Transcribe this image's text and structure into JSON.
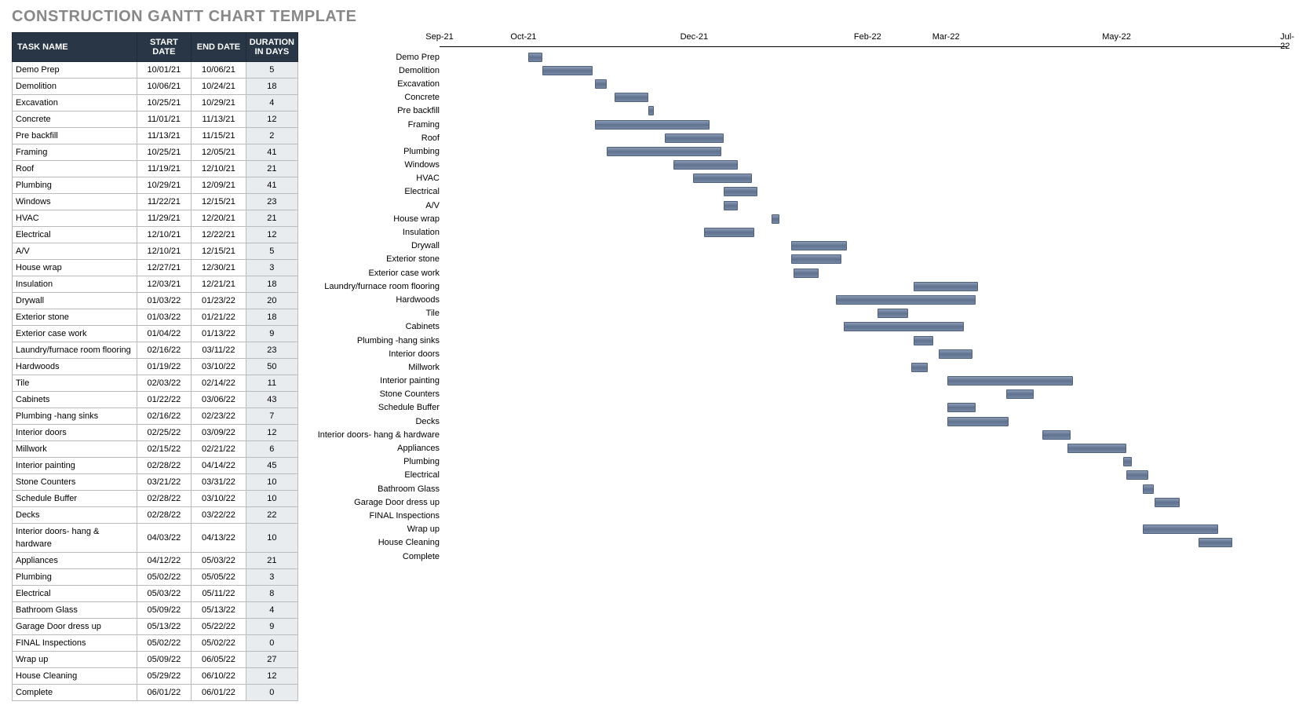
{
  "title": "CONSTRUCTION GANTT CHART TEMPLATE",
  "table": {
    "headers": {
      "name": "TASK NAME",
      "start": "START DATE",
      "end": "END DATE",
      "duration": "DURATION IN DAYS"
    }
  },
  "chart_data": {
    "type": "bar",
    "orientation": "horizontal-gantt",
    "x_axis": {
      "type": "date",
      "min": "2021-09-01",
      "max": "2022-07-01",
      "ticks": [
        "Sep-21",
        "Oct-21",
        "Dec-21",
        "Feb-22",
        "Mar-22",
        "May-22",
        "Jul-22"
      ],
      "tick_dates": [
        "2021-09-01",
        "2021-10-01",
        "2021-12-01",
        "2022-02-01",
        "2022-03-01",
        "2022-05-01",
        "2022-07-01"
      ]
    },
    "tasks": [
      {
        "name": "Demo Prep",
        "start": "10/01/21",
        "end": "10/06/21",
        "duration": 5
      },
      {
        "name": "Demolition",
        "start": "10/06/21",
        "end": "10/24/21",
        "duration": 18
      },
      {
        "name": "Excavation",
        "start": "10/25/21",
        "end": "10/29/21",
        "duration": 4
      },
      {
        "name": "Concrete",
        "start": "11/01/21",
        "end": "11/13/21",
        "duration": 12
      },
      {
        "name": "Pre backfill",
        "start": "11/13/21",
        "end": "11/15/21",
        "duration": 2
      },
      {
        "name": "Framing",
        "start": "10/25/21",
        "end": "12/05/21",
        "duration": 41
      },
      {
        "name": "Roof",
        "start": "11/19/21",
        "end": "12/10/21",
        "duration": 21
      },
      {
        "name": "Plumbing",
        "start": "10/29/21",
        "end": "12/09/21",
        "duration": 41
      },
      {
        "name": "Windows",
        "start": "11/22/21",
        "end": "12/15/21",
        "duration": 23
      },
      {
        "name": "HVAC",
        "start": "11/29/21",
        "end": "12/20/21",
        "duration": 21
      },
      {
        "name": "Electrical",
        "start": "12/10/21",
        "end": "12/22/21",
        "duration": 12
      },
      {
        "name": "A/V",
        "start": "12/10/21",
        "end": "12/15/21",
        "duration": 5
      },
      {
        "name": "House wrap",
        "start": "12/27/21",
        "end": "12/30/21",
        "duration": 3
      },
      {
        "name": "Insulation",
        "start": "12/03/21",
        "end": "12/21/21",
        "duration": 18
      },
      {
        "name": "Drywall",
        "start": "01/03/22",
        "end": "01/23/22",
        "duration": 20
      },
      {
        "name": "Exterior stone",
        "start": "01/03/22",
        "end": "01/21/22",
        "duration": 18
      },
      {
        "name": "Exterior case work",
        "start": "01/04/22",
        "end": "01/13/22",
        "duration": 9
      },
      {
        "name": "Laundry/furnace room flooring",
        "start": "02/16/22",
        "end": "03/11/22",
        "duration": 23
      },
      {
        "name": "Hardwoods",
        "start": "01/19/22",
        "end": "03/10/22",
        "duration": 50
      },
      {
        "name": "Tile",
        "start": "02/03/22",
        "end": "02/14/22",
        "duration": 11
      },
      {
        "name": "Cabinets",
        "start": "01/22/22",
        "end": "03/06/22",
        "duration": 43
      },
      {
        "name": "Plumbing -hang sinks",
        "start": "02/16/22",
        "end": "02/23/22",
        "duration": 7
      },
      {
        "name": "Interior doors",
        "start": "02/25/22",
        "end": "03/09/22",
        "duration": 12
      },
      {
        "name": "Millwork",
        "start": "02/15/22",
        "end": "02/21/22",
        "duration": 6
      },
      {
        "name": "Interior painting",
        "start": "02/28/22",
        "end": "04/14/22",
        "duration": 45
      },
      {
        "name": "Stone Counters",
        "start": "03/21/22",
        "end": "03/31/22",
        "duration": 10
      },
      {
        "name": "Schedule Buffer",
        "start": "02/28/22",
        "end": "03/10/22",
        "duration": 10
      },
      {
        "name": "Decks",
        "start": "02/28/22",
        "end": "03/22/22",
        "duration": 22
      },
      {
        "name": "Interior doors- hang & hardware",
        "start": "04/03/22",
        "end": "04/13/22",
        "duration": 10
      },
      {
        "name": "Appliances",
        "start": "04/12/22",
        "end": "05/03/22",
        "duration": 21
      },
      {
        "name": "Plumbing",
        "start": "05/02/22",
        "end": "05/05/22",
        "duration": 3
      },
      {
        "name": "Electrical",
        "start": "05/03/22",
        "end": "05/11/22",
        "duration": 8
      },
      {
        "name": "Bathroom Glass",
        "start": "05/09/22",
        "end": "05/13/22",
        "duration": 4
      },
      {
        "name": "Garage Door dress up",
        "start": "05/13/22",
        "end": "05/22/22",
        "duration": 9
      },
      {
        "name": "FINAL Inspections",
        "start": "05/02/22",
        "end": "05/02/22",
        "duration": 0
      },
      {
        "name": "Wrap up",
        "start": "05/09/22",
        "end": "06/05/22",
        "duration": 27
      },
      {
        "name": "House Cleaning",
        "start": "05/29/22",
        "end": "06/10/22",
        "duration": 12
      },
      {
        "name": "Complete",
        "start": "06/01/22",
        "end": "06/01/22",
        "duration": 0
      }
    ]
  }
}
